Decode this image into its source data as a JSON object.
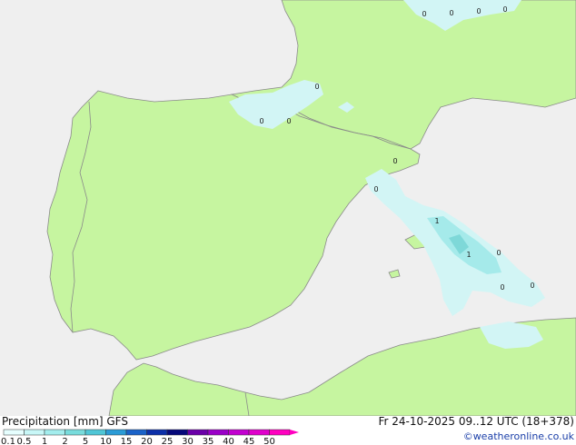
{
  "title": "Precipitation [mm] GFS",
  "datetime": "Fr 24-10-2025 09..12 UTC (18+378)",
  "credit": "©weatheronline.co.uk",
  "colors": {
    "sea": "#efefef",
    "land": "#c6f5a0",
    "coast": "#8a8a8a",
    "border": "#8a8a8a",
    "precip_light": "#d2f5f5",
    "precip_mid": "#a5eaea",
    "precip_strong": "#7ed8d8"
  },
  "legend": {
    "ticks": [
      "0.1",
      "0.5",
      "1",
      "2",
      "5",
      "10",
      "15",
      "20",
      "25",
      "30",
      "35",
      "40",
      "45",
      "50"
    ],
    "colors": [
      "#e6ffff",
      "#c8f7f7",
      "#a3eded",
      "#78dcdc",
      "#4fc6d6",
      "#2b9bd6",
      "#1a62c8",
      "#0c2fa8",
      "#06087a",
      "#6a00a8",
      "#9a00c8",
      "#c200d0",
      "#e000cc",
      "#ff00c0"
    ]
  },
  "value_labels": [
    "0",
    "0",
    "0",
    "0",
    "0",
    "0",
    "0",
    "0",
    "0",
    "1",
    "1",
    "0",
    "0",
    "0"
  ]
}
